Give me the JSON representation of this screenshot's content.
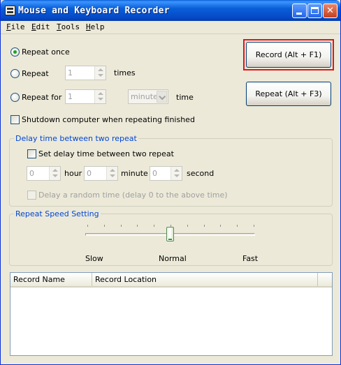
{
  "window": {
    "title": "Mouse and Keyboard Recorder"
  },
  "menu": [
    {
      "accel": "F",
      "rest": "ile"
    },
    {
      "accel": "E",
      "rest": "dit"
    },
    {
      "accel": "T",
      "rest": "ools"
    },
    {
      "accel": "H",
      "rest": "elp"
    }
  ],
  "repeat": {
    "once_label": "Repeat once",
    "repeat_label": "Repeat",
    "repeat_count": "1",
    "times_label": "times",
    "for_label": "Repeat for",
    "for_value": "1",
    "unit_selected": "minute",
    "time_label": "time",
    "shutdown_label": "Shutdown computer when repeating finished",
    "selected": "once"
  },
  "buttons": {
    "record": "Record (Alt + F1)",
    "repeat": "Repeat (Alt + F3)"
  },
  "delay": {
    "group_title": "Delay time between two repeat",
    "set_label": "Set delay time between two repeat",
    "hour_value": "0",
    "hour_label": "hour",
    "minute_value": "0",
    "minute_label": "minute",
    "second_value": "0",
    "second_label": "second",
    "random_label": "Delay a random time (delay 0 to the above time)"
  },
  "speed": {
    "group_title": "Repeat Speed Setting",
    "slow_label": "Slow",
    "normal_label": "Normal",
    "fast_label": "Fast",
    "level_fraction": 0.5,
    "tick_count": 11
  },
  "list": {
    "columns": [
      "Record Name",
      "Record Location"
    ]
  },
  "colors": {
    "titlebar": "#0a5fd8",
    "group_title": "#0046d5",
    "focus_ring": "#e0141e",
    "radio_dot": "#21a121"
  }
}
